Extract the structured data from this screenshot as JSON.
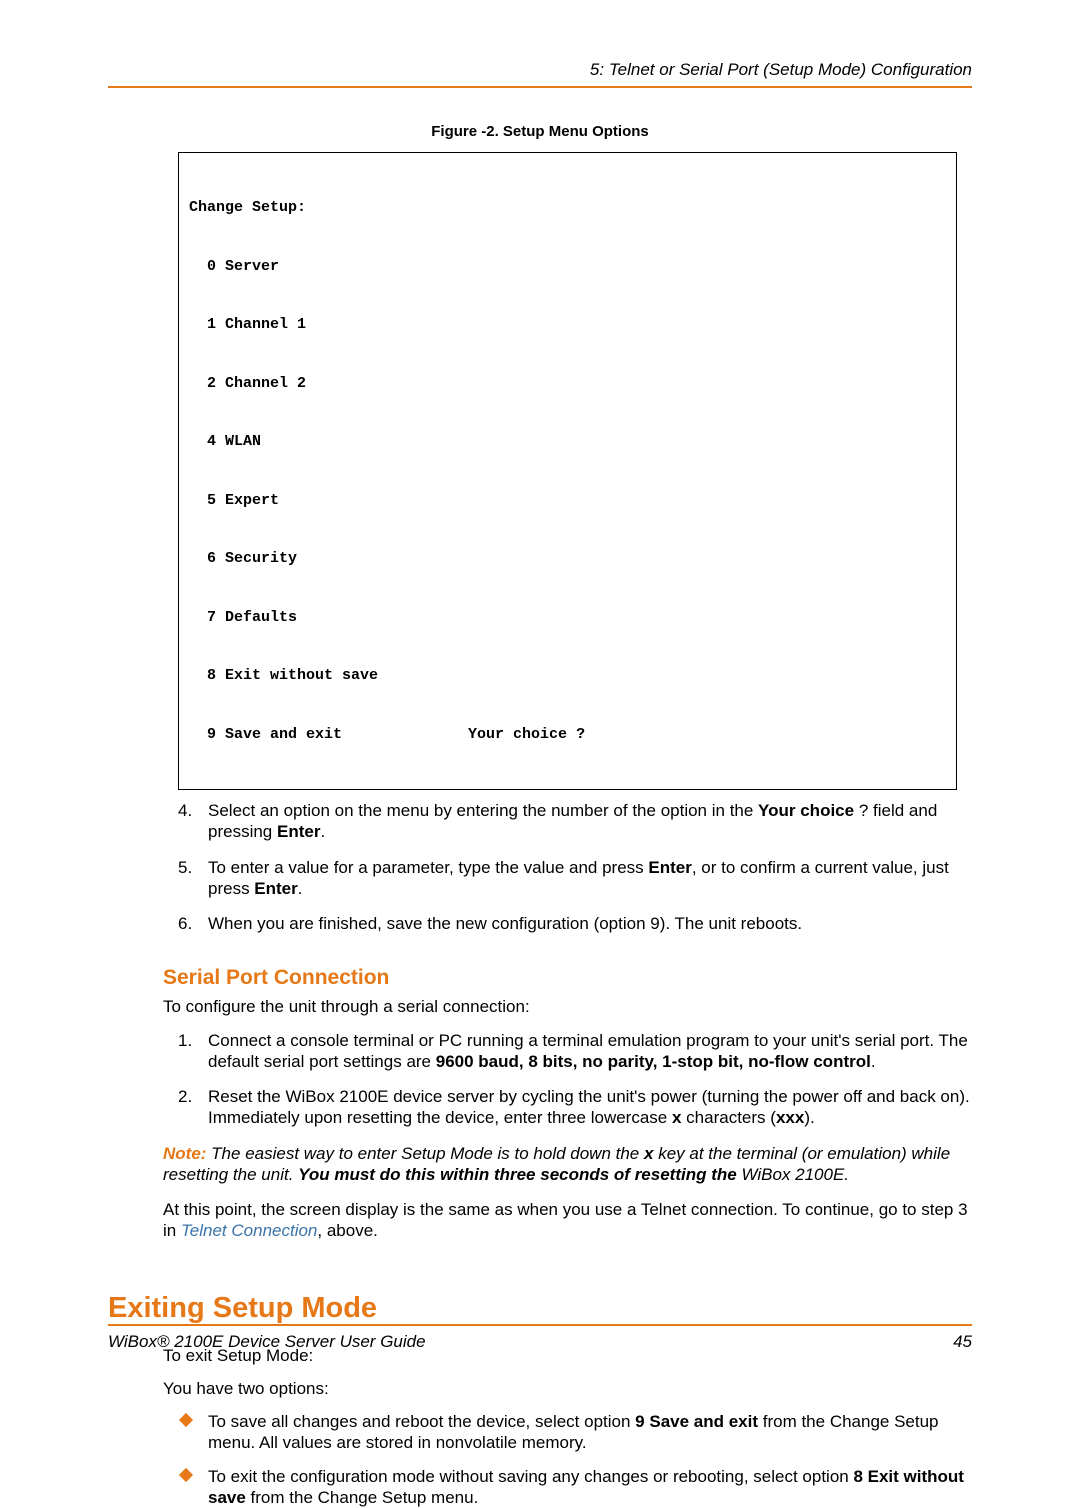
{
  "header": {
    "chapter": "5: Telnet or Serial Port (Setup Mode) Configuration"
  },
  "figure": {
    "caption": "Figure -2. Setup Menu Options",
    "lines": [
      "Change Setup:",
      "  0 Server",
      "  1 Channel 1",
      "  2 Channel 2",
      "  4 WLAN",
      "  5 Expert",
      "  6 Security",
      "  7 Defaults",
      "  8 Exit without save",
      "  9 Save and exit              Your choice ?"
    ]
  },
  "steps_a": {
    "s4": {
      "num": "4.",
      "t1": "Select an option on the menu by entering the number of the option in the ",
      "b1": "Your choice",
      "t2": " ? field and pressing ",
      "b2": "Enter",
      "t3": "."
    },
    "s5": {
      "num": "5.",
      "t1": "To enter a value for a parameter, type the value and press ",
      "b1": "Enter",
      "t2": ", or to confirm a current value, just press ",
      "b2": "Enter",
      "t3": "."
    },
    "s6": {
      "num": "6.",
      "t1": "When you are finished, save the new configuration (option 9). The unit reboots."
    }
  },
  "serial": {
    "heading": "Serial Port Connection",
    "intro": "To configure the unit through a serial connection:",
    "s1": {
      "num": "1.",
      "t1": "Connect a console terminal or PC running a terminal emulation program to your unit's serial port. The default serial port settings are ",
      "b1": "9600 baud, 8 bits, no parity, 1-stop bit, no-flow control",
      "t2": "."
    },
    "s2": {
      "num": "2.",
      "t1": "Reset the WiBox 2100E device server by cycling the unit's power (turning the power off and back on). Immediately upon resetting the device, enter three lowercase ",
      "b1": "x",
      "t2": " characters (",
      "b2": "xxx",
      "t3": ")."
    },
    "note": {
      "label": "Note:",
      "t1": " The easiest way to enter Setup Mode is to hold down the ",
      "b1": "x",
      "t2": " key at the terminal (or emulation) while resetting the unit. ",
      "b2": "You must do this within three seconds of resetting the ",
      "t3": "WiBox 2100E."
    },
    "after": {
      "t1": "At this point, the screen display is the same as when you use a Telnet connection. To continue, go to step 3 in ",
      "link": "Telnet Connection",
      "t2": ", above."
    }
  },
  "exiting": {
    "heading": "Exiting Setup Mode",
    "p1": "To exit Setup Mode:",
    "p2": "You have two options:",
    "b1": {
      "t1": "To save all changes and reboot the device, select option ",
      "bold": "9 Save and exit",
      "t2": " from the Change Setup menu. All values are stored in nonvolatile memory."
    },
    "b2": {
      "t1": "To exit the configuration mode without saving any changes or rebooting, select option ",
      "bold": "8 Exit without save",
      "t2": " from the Change Setup menu."
    }
  },
  "footer": {
    "title": "WiBox® 2100E Device Server User Guide",
    "page": "45"
  }
}
